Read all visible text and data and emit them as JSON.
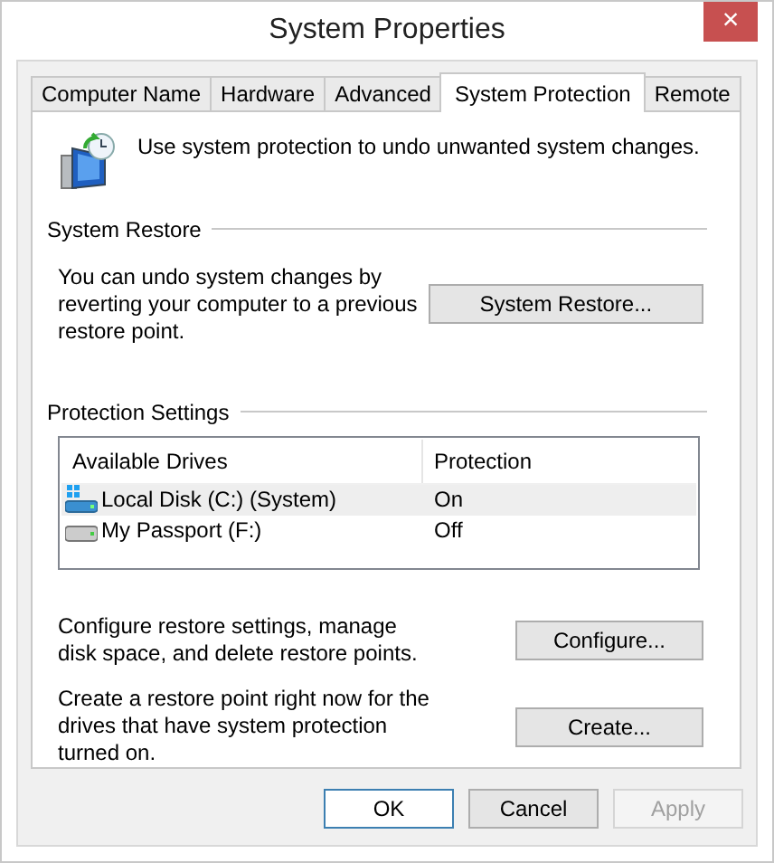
{
  "window": {
    "title": "System Properties",
    "close": "×"
  },
  "tabs": [
    {
      "label": "Computer Name",
      "selected": false
    },
    {
      "label": "Hardware",
      "selected": false
    },
    {
      "label": "Advanced",
      "selected": false
    },
    {
      "label": "System Protection",
      "selected": true
    },
    {
      "label": "Remote",
      "selected": false
    }
  ],
  "intro": "Use system protection to undo unwanted system changes.",
  "system_restore": {
    "heading": "System Restore",
    "text": "You can undo system changes by reverting your computer to a previous restore point.",
    "button": "System Restore..."
  },
  "protection_settings": {
    "heading": "Protection Settings",
    "table": {
      "columns": [
        "Available Drives",
        "Protection"
      ],
      "rows": [
        {
          "drive": "Local Disk (C:) (System)",
          "kind": "system",
          "protection": "On",
          "selected": true
        },
        {
          "drive": "My Passport (F:)",
          "kind": "external",
          "protection": "Off",
          "selected": false
        }
      ]
    },
    "actions": [
      {
        "text": "Configure restore settings, manage disk space, and delete restore points.",
        "button": "Configure..."
      },
      {
        "text": "Create a restore point right now for the drives that have system protection turned on.",
        "button": "Create..."
      }
    ]
  },
  "buttons": [
    {
      "label": "OK",
      "default": true,
      "disabled": false
    },
    {
      "label": "Cancel",
      "default": false,
      "disabled": false
    },
    {
      "label": "Apply",
      "default": false,
      "disabled": true
    }
  ]
}
